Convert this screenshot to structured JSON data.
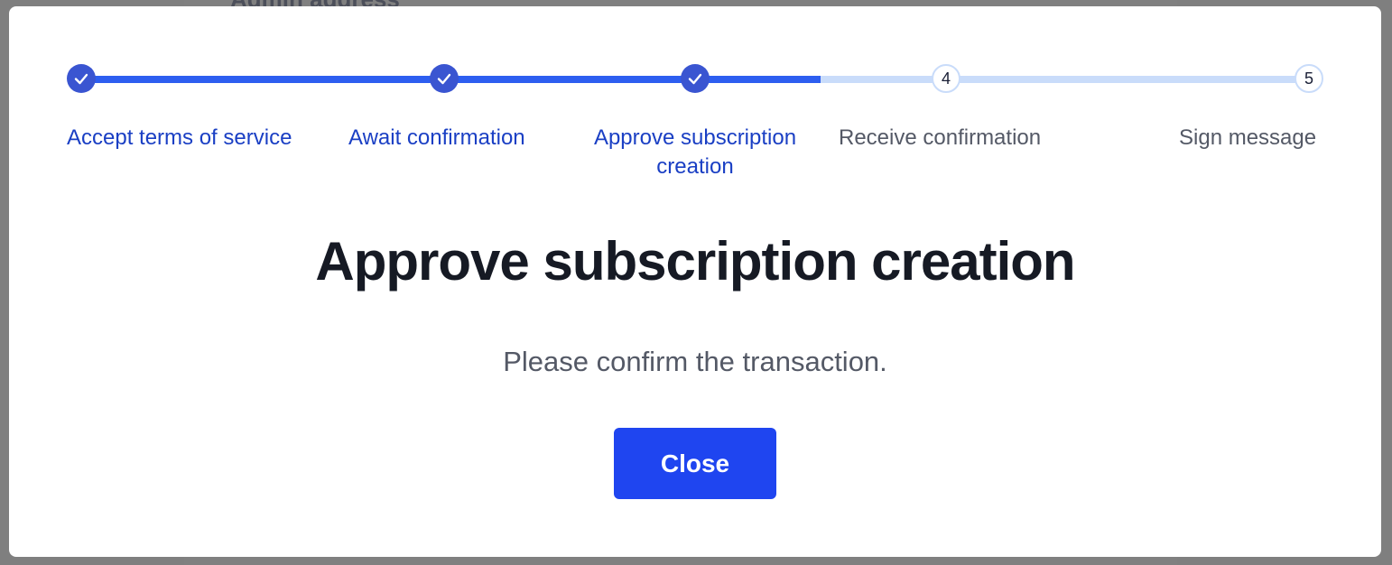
{
  "background": {
    "partial_heading": "Admin address"
  },
  "stepper": {
    "steps": [
      {
        "label": "Accept terms of service",
        "status": "completed",
        "number": "1"
      },
      {
        "label": "Await confirmation",
        "status": "completed",
        "number": "2"
      },
      {
        "label": "Approve subscription creation",
        "status": "current",
        "number": "3"
      },
      {
        "label": "Receive confirmation",
        "status": "pending",
        "number": "4"
      },
      {
        "label": "Sign message",
        "status": "pending",
        "number": "5"
      }
    ],
    "colors": {
      "completed_node": "#3a55d1",
      "completed_track": "#2d5ef0",
      "pending_track": "#c9dcfa",
      "completed_label": "#1a3fc4",
      "pending_label": "#545966"
    }
  },
  "dialog": {
    "title": "Approve subscription creation",
    "message": "Please confirm the transaction.",
    "close_label": "Close",
    "accent": "#1f45f0"
  }
}
